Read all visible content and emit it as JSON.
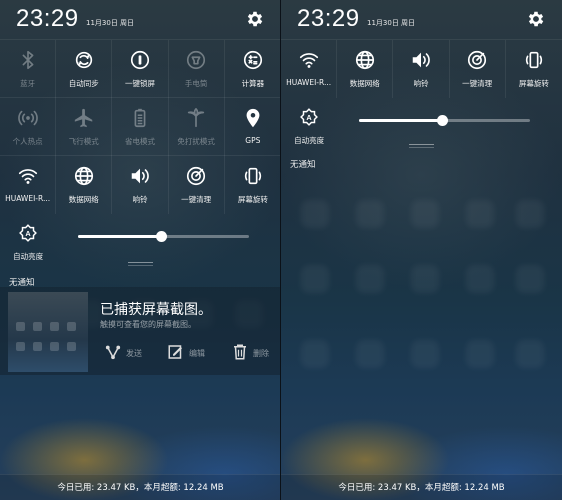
{
  "status": {
    "time": "23:29",
    "date": "11月30日 周日"
  },
  "left_tiles": [
    {
      "label": "蓝牙",
      "icon": "bluetooth-icon",
      "active": false
    },
    {
      "label": "自动同步",
      "icon": "sync-icon",
      "active": true
    },
    {
      "label": "一键锁屏",
      "icon": "lock-screen-icon",
      "active": true
    },
    {
      "label": "手电筒",
      "icon": "flashlight-icon",
      "active": false
    },
    {
      "label": "计算器",
      "icon": "calculator-icon",
      "active": true
    },
    {
      "label": "个人热点",
      "icon": "hotspot-icon",
      "active": false
    },
    {
      "label": "飞行模式",
      "icon": "airplane-icon",
      "active": false
    },
    {
      "label": "省电模式",
      "icon": "battery-saver-icon",
      "active": false
    },
    {
      "label": "免打扰模式",
      "icon": "do-not-disturb-icon",
      "active": false
    },
    {
      "label": "GPS",
      "icon": "gps-icon",
      "active": true
    },
    {
      "label": "HUAWEI-R...",
      "icon": "wifi-icon",
      "active": true
    },
    {
      "label": "数据网络",
      "icon": "globe-icon",
      "active": true
    },
    {
      "label": "响铃",
      "icon": "speaker-icon",
      "active": true
    },
    {
      "label": "一键清理",
      "icon": "cleanup-icon",
      "active": true
    },
    {
      "label": "屏幕旋转",
      "icon": "rotate-icon",
      "active": true
    }
  ],
  "right_tiles": [
    {
      "label": "HUAWEI-R...",
      "icon": "wifi-icon",
      "active": true
    },
    {
      "label": "数据网络",
      "icon": "globe-icon",
      "active": true
    },
    {
      "label": "响铃",
      "icon": "speaker-icon",
      "active": true
    },
    {
      "label": "一键清理",
      "icon": "cleanup-icon",
      "active": true
    },
    {
      "label": "屏幕旋转",
      "icon": "rotate-icon",
      "active": true
    }
  ],
  "brightness": {
    "label": "自动亮度",
    "icon": "auto-brightness-icon",
    "level_left": 0.49,
    "level_right": 0.49
  },
  "notifications": {
    "empty_label": "无通知"
  },
  "screenshot_notification": {
    "title": "已捕获屏幕截图。",
    "subtitle": "触摸可查看您的屏幕截图。",
    "actions": [
      {
        "label": "发送",
        "icon": "share-icon"
      },
      {
        "label": "编辑",
        "icon": "edit-icon"
      },
      {
        "label": "删除",
        "icon": "trash-icon"
      }
    ]
  },
  "footer": {
    "data_usage": "今日已用: 23.47 KB，本月超额: 12.24 MB"
  },
  "colors": {
    "accent": "#ffffff",
    "inactive": "#7d868c"
  }
}
